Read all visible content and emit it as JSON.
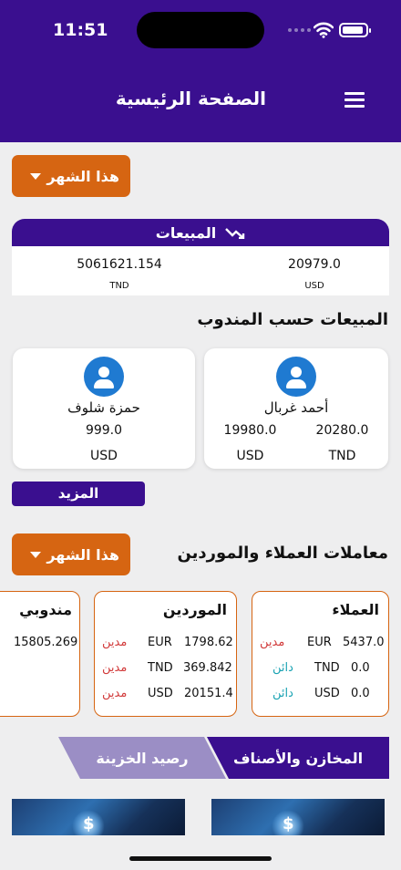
{
  "status_bar": {
    "time": "11:51"
  },
  "header": {
    "title": "الصفحة الرئيسية"
  },
  "period_filter_1": {
    "label": "هذا الشهر"
  },
  "sales": {
    "title": "المبيعات",
    "values": [
      {
        "value": "20979.0",
        "currency": "USD"
      },
      {
        "value": "5061621.154",
        "currency": "TND"
      }
    ]
  },
  "reps_section": {
    "title": "المبيعات حسب المندوب",
    "reps": [
      {
        "name": "أحمد غربال",
        "amounts": [
          {
            "value": "19980.0",
            "currency": "USD"
          },
          {
            "value": "20280.0",
            "currency": "TND"
          }
        ]
      },
      {
        "name": "حمزة شلوف",
        "amounts": [
          {
            "value": "999.0",
            "currency": "USD"
          }
        ]
      }
    ],
    "more_label": "المزيد"
  },
  "dealings_section": {
    "title": "معاملات العملاء والموردين",
    "filter_label": "هذا الشهر",
    "customers": {
      "title": "العملاء",
      "rows": [
        {
          "amount": "5437.0",
          "currency": "EUR",
          "status": "مدين"
        },
        {
          "amount": "0.0",
          "currency": "TND",
          "status": "دائن"
        },
        {
          "amount": "0.0",
          "currency": "USD",
          "status": "دائن"
        }
      ]
    },
    "suppliers": {
      "title": "الموردين",
      "rows": [
        {
          "amount": "1798.62",
          "currency": "EUR",
          "status": "مدين"
        },
        {
          "amount": "369.842",
          "currency": "TND",
          "status": "مدين"
        },
        {
          "amount": "20151.4",
          "currency": "USD",
          "status": "مدين"
        }
      ]
    },
    "reps_partial": {
      "title": "مندوبي",
      "value": "15805.269"
    }
  },
  "tabs": {
    "inventory": "المخازن والأصناف",
    "treasury": "رصيد الخزينة"
  },
  "colors": {
    "primary": "#3a0f8f",
    "accent": "#d66512",
    "debit": "#d23c3c",
    "credit": "#1aa3b3",
    "avatar": "#1f7ad1"
  },
  "icons": [
    "menu-icon",
    "trend-icon",
    "user-icon",
    "wifi-icon",
    "battery-icon",
    "dollar-icon"
  ]
}
